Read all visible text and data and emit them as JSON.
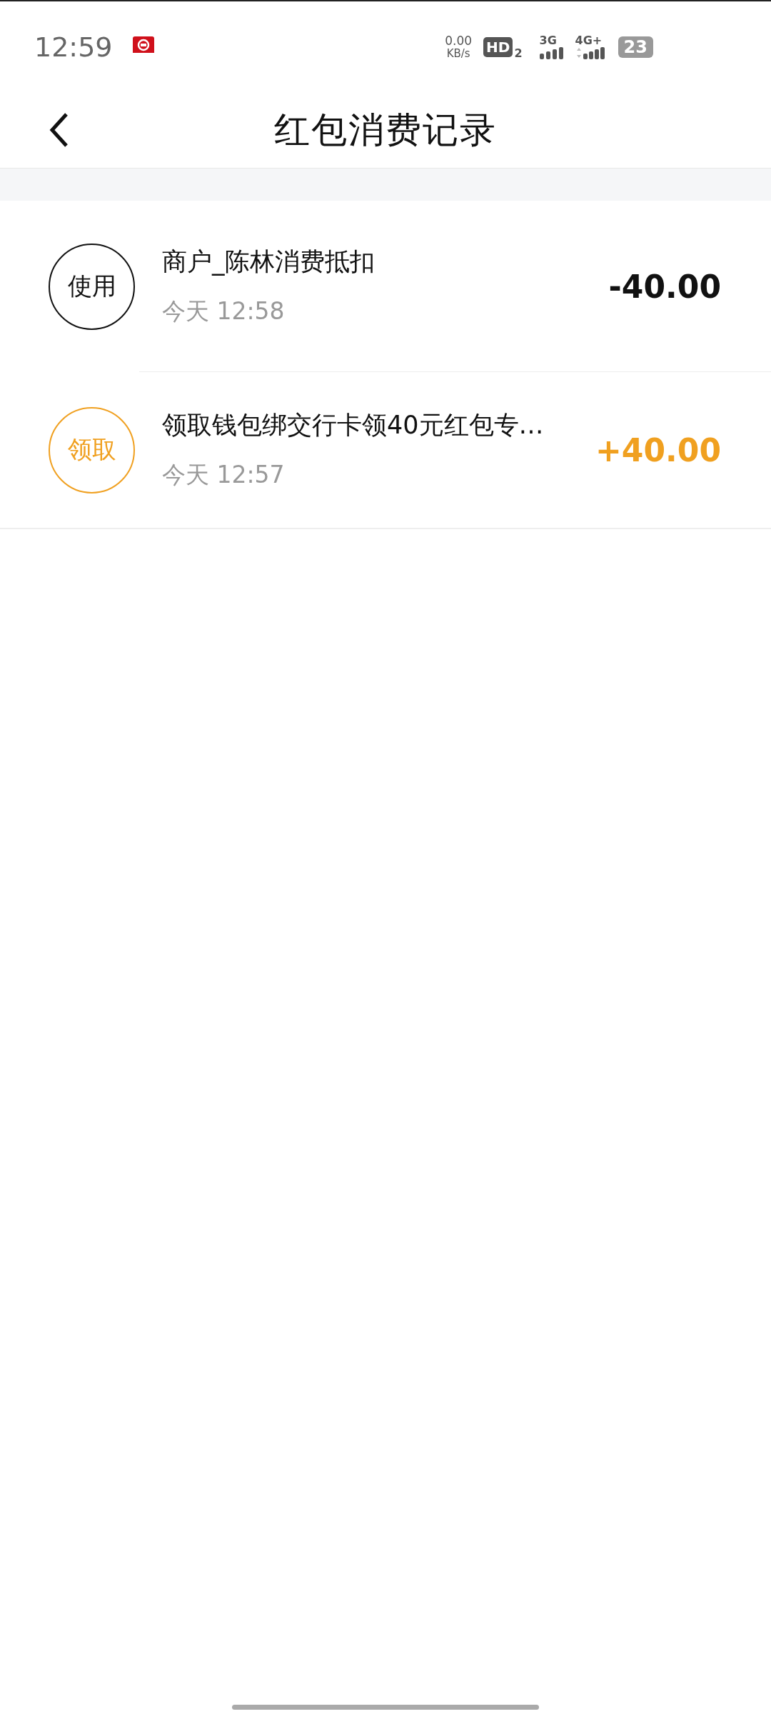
{
  "status_bar": {
    "time": "12:59",
    "net_speed": "0.00",
    "net_unit": "KB/s",
    "hd": "HD",
    "hd_sub": "2",
    "sig1": "3G",
    "sig2": "4G+",
    "battery": "23"
  },
  "nav": {
    "title": "红包消费记录"
  },
  "records": [
    {
      "kind": "use",
      "badge": "使用",
      "title": "商户_陈林消费抵扣",
      "time": "今天 12:58",
      "amount": "-40.00"
    },
    {
      "kind": "receive",
      "badge": "领取",
      "title": "领取钱包绑交行卡领40元红包专…",
      "time": "今天 12:57",
      "amount": "+40.00"
    }
  ]
}
